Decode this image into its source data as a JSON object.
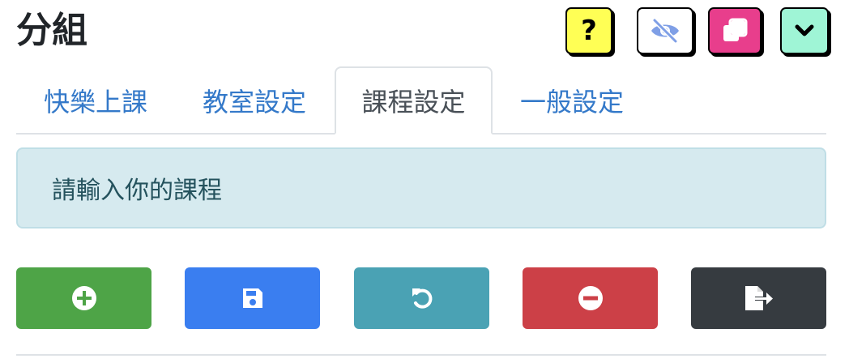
{
  "header": {
    "title": "分組",
    "help_label": "?"
  },
  "toolbar_icons": {
    "help": "question-icon",
    "hide": "eye-slash-icon",
    "copy": "copy-icon",
    "collapse": "chevron-down-icon"
  },
  "tabs": [
    {
      "label": "快樂上課",
      "active": false
    },
    {
      "label": "教室設定",
      "active": false
    },
    {
      "label": "課程設定",
      "active": true
    },
    {
      "label": "一般設定",
      "active": false
    }
  ],
  "alert": {
    "text": "請輸入你的課程"
  },
  "actions": [
    {
      "icon": "plus-circle-icon",
      "color": "#4ea447"
    },
    {
      "icon": "save-icon",
      "color": "#3a7ef0"
    },
    {
      "icon": "undo-icon",
      "color": "#4aa2b4"
    },
    {
      "icon": "minus-circle-icon",
      "color": "#cc4047"
    },
    {
      "icon": "file-export-icon",
      "color": "#363b40"
    }
  ],
  "colors": {
    "help_button": "#ffff55",
    "copy_button": "#e83e8c",
    "collapse_button": "#9ff5d6",
    "tab_link": "#3479c9",
    "alert_bg": "#d6eaef"
  }
}
